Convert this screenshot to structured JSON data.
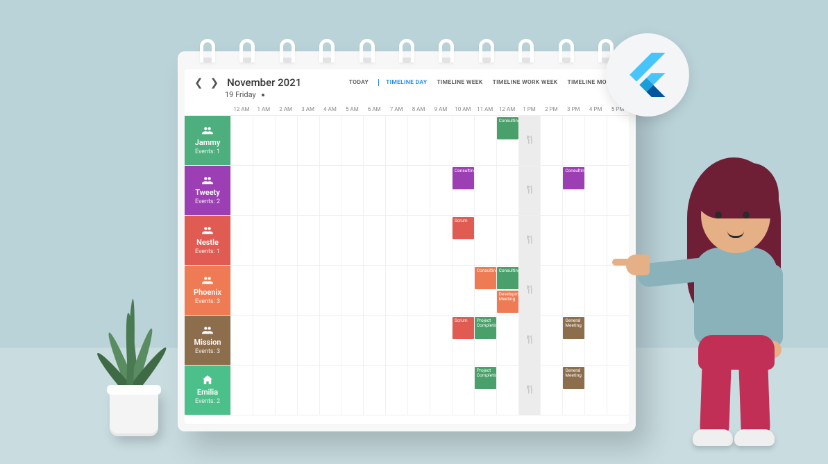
{
  "header": {
    "title": "November 2021",
    "subtitle": "19 Friday",
    "today_label": "TODAY",
    "views": [
      {
        "label": "TIMELINE DAY",
        "active": true
      },
      {
        "label": "TIMELINE WEEK",
        "active": false
      },
      {
        "label": "TIMELINE WORK WEEK",
        "active": false
      },
      {
        "label": "TIMELINE MONTH",
        "active": false
      }
    ]
  },
  "time_slots": [
    "12 AM",
    "1 AM",
    "2 AM",
    "3 AM",
    "4 AM",
    "5 AM",
    "6 AM",
    "7 AM",
    "8 AM",
    "9 AM",
    "10 AM",
    "11 AM",
    "12 AM",
    "1 PM",
    "2 PM",
    "3 PM",
    "4 PM",
    "5 PM"
  ],
  "break_column_index": 14,
  "resources": [
    {
      "name": "Jammy",
      "events_label": "Events: 1",
      "color": "c-green1",
      "icon": "people",
      "appointments": [
        {
          "label": "Consulting",
          "col": 12,
          "span": 1,
          "color": "c-green3"
        }
      ]
    },
    {
      "name": "Tweety",
      "events_label": "Events: 2",
      "color": "c-purple",
      "icon": "people",
      "appointments": [
        {
          "label": "Consulting",
          "col": 10,
          "span": 1,
          "color": "c-purple"
        },
        {
          "label": "Consulting",
          "col": 15,
          "span": 1,
          "color": "c-purple"
        }
      ]
    },
    {
      "name": "Nestle",
      "events_label": "Events: 1",
      "color": "c-red",
      "icon": "people",
      "appointments": [
        {
          "label": "Scrum",
          "col": 10,
          "span": 1,
          "color": "c-red"
        }
      ]
    },
    {
      "name": "Phoenix",
      "events_label": "Events: 3",
      "color": "c-orange",
      "icon": "people",
      "appointments": [
        {
          "label": "Consulting",
          "col": 11,
          "span": 1,
          "color": "c-orange"
        },
        {
          "label": "Consulting",
          "col": 12,
          "span": 1,
          "color": "c-green3"
        },
        {
          "label": "Development Meeting",
          "col": 12,
          "span": 1,
          "row": 2,
          "color": "c-orange"
        }
      ]
    },
    {
      "name": "Mission",
      "events_label": "Events: 3",
      "color": "c-brown",
      "icon": "people",
      "appointments": [
        {
          "label": "Scrum",
          "col": 10,
          "span": 1,
          "color": "c-red"
        },
        {
          "label": "Project Completion",
          "col": 11,
          "span": 1,
          "color": "c-green3"
        },
        {
          "label": "General Meeting",
          "col": 15,
          "span": 1,
          "color": "c-brown"
        }
      ]
    },
    {
      "name": "Emilia",
      "events_label": "Events: 2",
      "color": "c-green2",
      "icon": "house",
      "appointments": [
        {
          "label": "Project Completion",
          "col": 11,
          "span": 1,
          "color": "c-green3"
        },
        {
          "label": "General Meeting",
          "col": 15,
          "span": 1,
          "color": "c-brown"
        }
      ]
    }
  ]
}
